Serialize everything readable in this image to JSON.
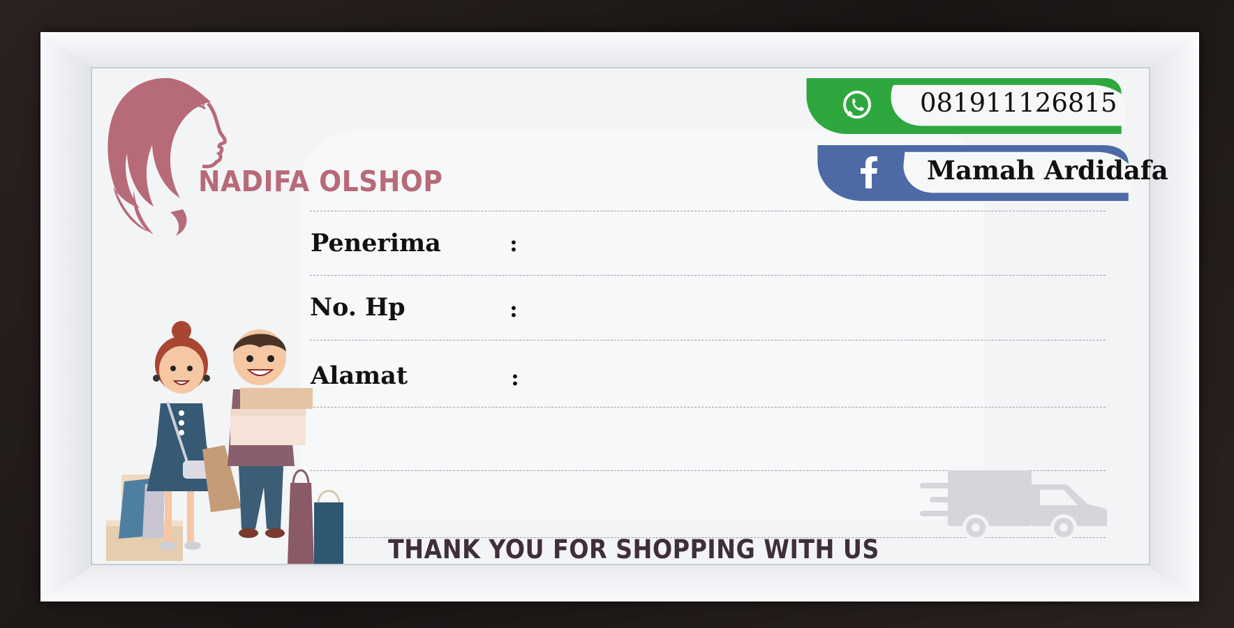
{
  "brand": {
    "name": "NADIFA OLSHOP",
    "primary_color": "#b76a78"
  },
  "contacts": {
    "whatsapp": {
      "icon": "whatsapp-icon",
      "number": "081911126815",
      "color": "#2ea73f"
    },
    "facebook": {
      "icon": "facebook-icon",
      "name": "Mamah Ardidafa",
      "color": "#4d6aa6"
    }
  },
  "fields": [
    {
      "label": "Penerima",
      "colon": ":"
    },
    {
      "label": "No. Hp",
      "colon": ":"
    },
    {
      "label": "Alamat",
      "colon": ":"
    }
  ],
  "footer": {
    "thanks": "THANK YOU FOR SHOPPING WITH US"
  },
  "illustrations": {
    "logo": "woman-profile-logo",
    "shoppers": "shopping-couple-illustration",
    "delivery": "delivery-truck-icon"
  }
}
